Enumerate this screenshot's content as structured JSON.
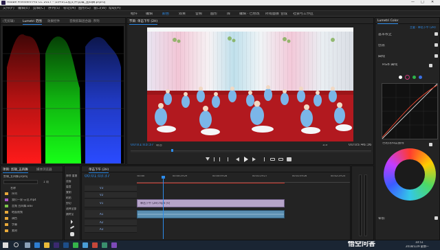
{
  "app": {
    "title": "Adobe Premiere Pro CC 2017 - \\1\\Pro\\工程文件\\剪辑_五四舞.prproj",
    "window_controls": [
      "—",
      "□",
      "✕"
    ]
  },
  "menu": [
    "文件(F)",
    "编辑(E)",
    "剪辑(C)",
    "序列(S)",
    "标记(M)",
    "图形(G)",
    "窗口(W)",
    "帮助(H)"
  ],
  "workspaces": [
    "组件",
    "编辑",
    "颜色",
    "效果",
    "音频",
    "图形",
    "库",
    "编辑 · 已修改",
    "所有面板",
    "合成",
    "社会与工作区"
  ],
  "scopes": {
    "tabs": [
      "(无剪辑)",
      "Lumetri 范围",
      "效果控件",
      "音频剪辑混合器: 序列"
    ],
    "colors": [
      "#ff1a1a",
      "#17ff17",
      "#2a4bff"
    ]
  },
  "program": {
    "tab": "节目: 单击下午 (2H)",
    "timecode_current": "00:01:03:37",
    "fit": "适合",
    "resolution": "1/3",
    "timecode_duration": "00:05:46:36"
  },
  "project": {
    "tabs": [
      "项目: 剪辑_五四舞",
      "媒体浏览器"
    ],
    "file": "剪辑_五四舞.prproj",
    "search_placeholder": "",
    "item_count": "1 项",
    "header": "名称",
    "items": [
      {
        "name": "序列",
        "color": "#e8a93a"
      },
      {
        "name": "我们一家-示范.mp4",
        "color": "#ad57c7"
      },
      {
        "name": "音频 五四舞.wav",
        "color": "#7cc54a"
      },
      {
        "name": "地面视频",
        "color": "#e8a93a"
      },
      {
        "name": "调色",
        "color": "#e8a93a"
      },
      {
        "name": "字幕",
        "color": "#e8a93a"
      },
      {
        "name": "素材",
        "color": "#e8a93a"
      }
    ]
  },
  "tools_menu": {
    "items": [
      "移除  重复",
      "连接",
      "重置",
      "复制",
      "粘贴",
      "剪切",
      "选择全部",
      "跳转至"
    ]
  },
  "timeline": {
    "tab": "单击下午 (2H)",
    "timecode": "00:01:03:37",
    "ruler": [
      ":00:00",
      "00:00:29:29",
      "00:00:59:28",
      "00:01:29:27",
      "00:01:59:26",
      "00:02:29:25"
    ],
    "tracks": [
      "V3",
      "V2",
      "V1",
      "A1",
      "A2",
      "A3"
    ],
    "video_clip": "单击下午 (2H).mp4 [V]",
    "audio_clip": ""
  },
  "lumetri": {
    "title": "Lumetri Color",
    "master": "主要 · 单击下午 (2H)",
    "sections": [
      "基本校正",
      "创意",
      "曲线",
      "RGB 曲线",
      "色相饱和度曲线"
    ],
    "wheel_section": "色相饱和度曲线",
    "vignette": "晕影"
  },
  "taskbar": {
    "time": "10:51",
    "date": "2018/1/29 星期一",
    "watermark": "悟空问答"
  }
}
